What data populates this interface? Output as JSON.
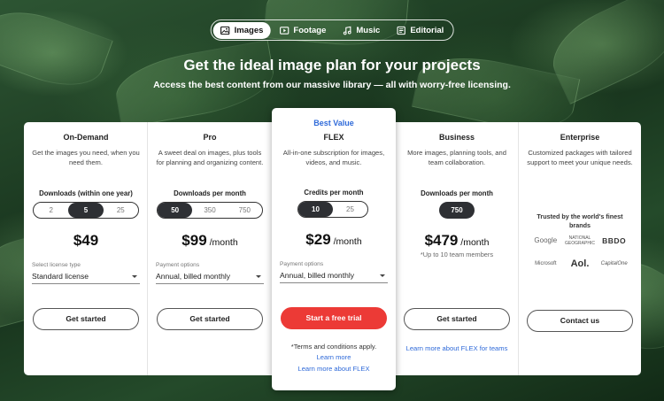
{
  "tabs": [
    {
      "label": "Images",
      "icon": "image-icon",
      "active": true
    },
    {
      "label": "Footage",
      "icon": "play-icon",
      "active": false
    },
    {
      "label": "Music",
      "icon": "music-note-icon",
      "active": false
    },
    {
      "label": "Editorial",
      "icon": "newspaper-icon",
      "active": false
    }
  ],
  "hero": {
    "title": "Get the ideal image plan for your projects",
    "subtitle": "Access the best content from our massive library — all with worry-free licensing."
  },
  "plans": {
    "ondemand": {
      "name": "On-Demand",
      "desc": "Get the images you need, when you need them.",
      "dl_label": "Downloads (within one year)",
      "options": [
        "2",
        "5",
        "25"
      ],
      "selected": "5",
      "price": "$49",
      "select_label": "Select license type",
      "select_value": "Standard license",
      "button": "Get started"
    },
    "pro": {
      "name": "Pro",
      "desc": "A sweet deal on images, plus tools for planning and organizing content.",
      "dl_label": "Downloads per month",
      "options": [
        "50",
        "350",
        "750"
      ],
      "selected": "50",
      "price": "$99",
      "price_unit": " /month",
      "select_label": "Payment options",
      "select_value": "Annual, billed monthly",
      "button": "Get started"
    },
    "flex": {
      "badge": "Best Value",
      "name": "FLEX",
      "desc": "All-in-one subscription for images, videos, and music.",
      "dl_label": "Credits per month",
      "options": [
        "10",
        "25"
      ],
      "selected": "10",
      "price": "$29",
      "price_unit": " /month",
      "select_label": "Payment options",
      "select_value": "Annual, billed monthly",
      "button": "Start a free trial",
      "terms": "*Terms and conditions apply.",
      "link1": "Learn more",
      "link2": "Learn more about FLEX"
    },
    "business": {
      "name": "Business",
      "desc": "More images, planning tools, and team collaboration.",
      "dl_label": "Downloads per month",
      "selected": "750",
      "price": "$479",
      "price_unit": " /month",
      "note": "*Up to 10 team members",
      "button": "Get started",
      "link": "Learn more about FLEX for teams"
    },
    "enterprise": {
      "name": "Enterprise",
      "desc": "Customized packages with tailored support to meet your unique needs.",
      "trusted": "Trusted by the world's finest brands",
      "logos": [
        "Google",
        "NATIONAL GEOGRAPHIC",
        "BBDO",
        "Microsoft",
        "Aol.",
        "CapitalOne"
      ],
      "button": "Contact us"
    }
  },
  "colors": {
    "accent_red": "#ec3a36",
    "link_blue": "#2f6ad9",
    "pill_dark": "#2e3034"
  }
}
